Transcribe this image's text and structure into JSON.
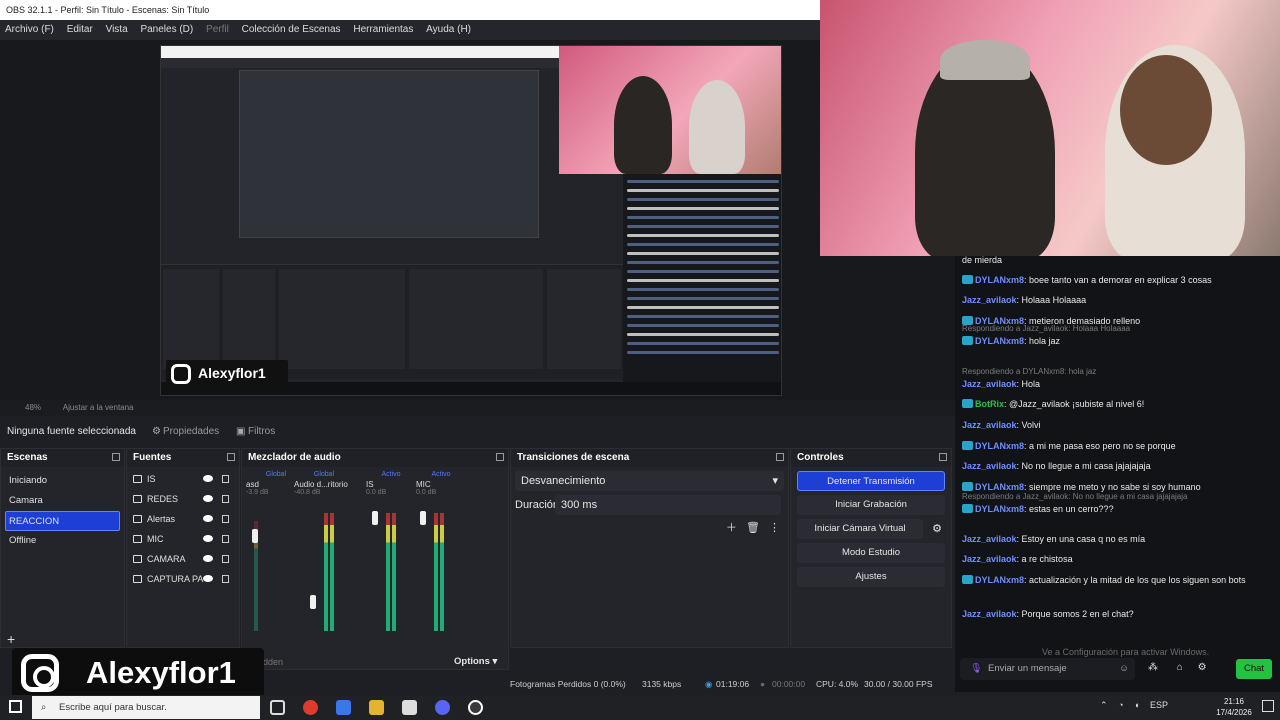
{
  "window": {
    "title": "OBS 32.1.1 - Perfil: Sin Título - Escenas: Sin Título"
  },
  "menu": [
    "Archivo (F)",
    "Editar",
    "Vista",
    "Paneles (D)",
    "Perfil",
    "Colección de Escenas",
    "Herramientas",
    "Ayuda (H)"
  ],
  "preview": {
    "brand_name": "Alexyflor1"
  },
  "zoom": {
    "level": "48%",
    "fit_label": "Ajustar a la ventana"
  },
  "source_toolbar": {
    "no_source": "Ninguna fuente seleccionada",
    "properties": "Propiedades",
    "filters": "Filtros"
  },
  "scenes": {
    "title": "Escenas",
    "items": [
      {
        "label": "Iniciando"
      },
      {
        "label": "Camara"
      },
      {
        "label": "REACCION",
        "selected": true
      },
      {
        "label": "Offline"
      }
    ]
  },
  "sources": {
    "title": "Fuentes",
    "items": [
      {
        "label": "IS",
        "icon": "monitor-icon"
      },
      {
        "label": "REDES",
        "icon": "globe-icon"
      },
      {
        "label": "Alertas",
        "icon": "globe-icon"
      },
      {
        "label": "MIC",
        "icon": "microphone-icon"
      },
      {
        "label": "CAMARA",
        "icon": "camera-icon"
      },
      {
        "label": "CAPTURA PA",
        "icon": "window-icon"
      }
    ]
  },
  "mixer": {
    "title": "Mezclador de audio",
    "channels": [
      {
        "tag": "Global",
        "name": "asd",
        "db": "-3.9 dB"
      },
      {
        "tag": "Global",
        "name": "Audio d...ritorio",
        "db": "-40.8 dB"
      },
      {
        "tag": "Activo",
        "name": "IS",
        "db": "0.0 dB"
      },
      {
        "tag": "Activo",
        "name": "MIC",
        "db": "0.0 dB"
      }
    ],
    "hidden_label": "hidden",
    "options_label": "Options"
  },
  "transitions": {
    "title": "Transiciones de escena",
    "selected": "Desvanecimiento",
    "duration_label": "Duración",
    "duration_value": "300 ms"
  },
  "controls": {
    "title": "Controles",
    "buttons": [
      "Detener Transmisión",
      "Iniciar Grabación",
      "Iniciar Cámara Virtual",
      "Modo Estudio",
      "Ajustes"
    ]
  },
  "status": {
    "dropped": "Fotogramas Perdidos 0 (0.0%)",
    "bitrate": "3135 kbps",
    "stream_time": "01:19:06",
    "rec_time": "00:00:00",
    "cpu": "CPU: 4.0%",
    "fps": "30.00 / 30.00 FPS"
  },
  "chat": {
    "messages": [
      {
        "user": "",
        "text": "de mierda"
      },
      {
        "user": "DYLANxm8",
        "text": ": boee tanto van a demorar en explicar 3 cosas",
        "badge": true
      },
      {
        "user": "Jazz_avilaok",
        "text": ": Holaaa Holaaaa"
      },
      {
        "user": "DYLANxm8",
        "text": ": metieron demasiado relleno",
        "badge": true
      },
      {
        "reply": "Respondiendo a Jazz_avilaok: Holaaa Holaaaa",
        "user": "DYLANxm8",
        "text": ": hola jaz",
        "badge": true
      },
      {
        "reply": "Respondiendo a DYLANxm8: hola jaz",
        "user": "Jazz_avilaok",
        "text": ": Hola"
      },
      {
        "user": "BotRix",
        "text": ": @Jazz_avilaok ¡subiste al nivel 6!",
        "green": true,
        "badge": true
      },
      {
        "user": "Jazz_avilaok",
        "text": ": Volvi"
      },
      {
        "user": "DYLANxm8",
        "text": ": a mi me pasa eso pero no se porque",
        "badge": true
      },
      {
        "user": "Jazz_avilaok",
        "text": ": No no llegue a mi casa jajajajaja"
      },
      {
        "user": "DYLANxm8",
        "text": ": siempre me meto y no sabe si soy humano",
        "badge": true
      },
      {
        "reply": "Respondiendo a Jazz_avilaok: No no llegue a mi casa jajajajaja",
        "user": "DYLANxm8",
        "text": ": estas en un cerro???",
        "badge": true
      },
      {
        "user": "Jazz_avilaok",
        "text": ": Estoy en una casa q no es mía"
      },
      {
        "user": "Jazz_avilaok",
        "text": ": a re chistosa"
      },
      {
        "user": "DYLANxm8",
        "text": ": actualización y la mitad de los que los siguen son bots",
        "badge": true
      },
      {
        "user": "Jazz_avilaok",
        "text": ": Porque somos 2 en el chat?"
      }
    ],
    "input_placeholder": "Enviar un mensaje",
    "send_label": "Chat",
    "watermark": "Ve a Configuración para activar Windows."
  },
  "brand": {
    "name": "Alexyflor1"
  },
  "taskbar": {
    "search_placeholder": "Escribe aquí para buscar.",
    "lang": "ESP",
    "time": "21:16",
    "date": "17/4/2026"
  },
  "colors": {
    "accent": "#1d3fd6",
    "chat_user": "#6f8fff",
    "chat_send": "#22c341"
  }
}
